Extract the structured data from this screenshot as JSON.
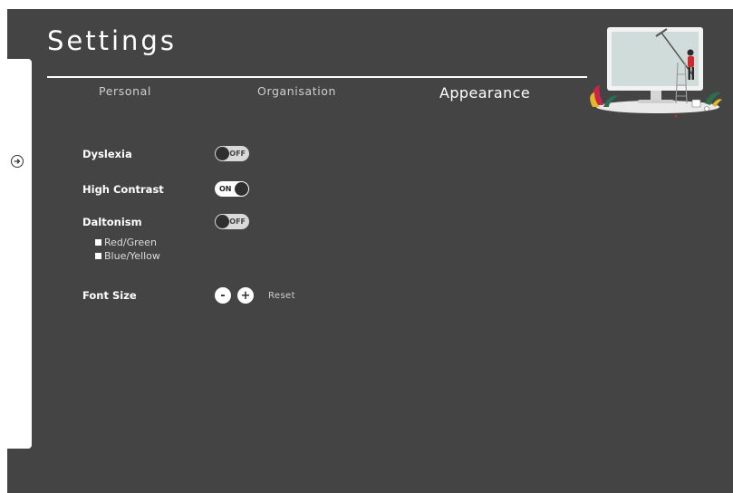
{
  "header": {
    "title": "Settings"
  },
  "tabs": [
    {
      "label": "Personal",
      "active": false
    },
    {
      "label": "Organisation",
      "active": false
    },
    {
      "label": "Appearance",
      "active": true
    }
  ],
  "sidebar": {
    "toggle_icon": "arrow-right-circle-icon"
  },
  "settings": {
    "dyslexia": {
      "label": "Dyslexia",
      "state": "OFF"
    },
    "high_contrast": {
      "label": "High Contrast",
      "state": "ON"
    },
    "daltonism": {
      "label": "Daltonism",
      "state": "OFF",
      "options": [
        {
          "label": "Red/Green",
          "checked": false
        },
        {
          "label": "Blue/Yellow",
          "checked": false
        }
      ]
    },
    "font_size": {
      "label": "Font Size",
      "decrease_label": "-",
      "increase_label": "+",
      "reset_label": "Reset"
    }
  },
  "colors": {
    "background": "#444444",
    "panel": "#ffffff",
    "text": "#ffffff",
    "muted_text": "#cfcfcf"
  }
}
